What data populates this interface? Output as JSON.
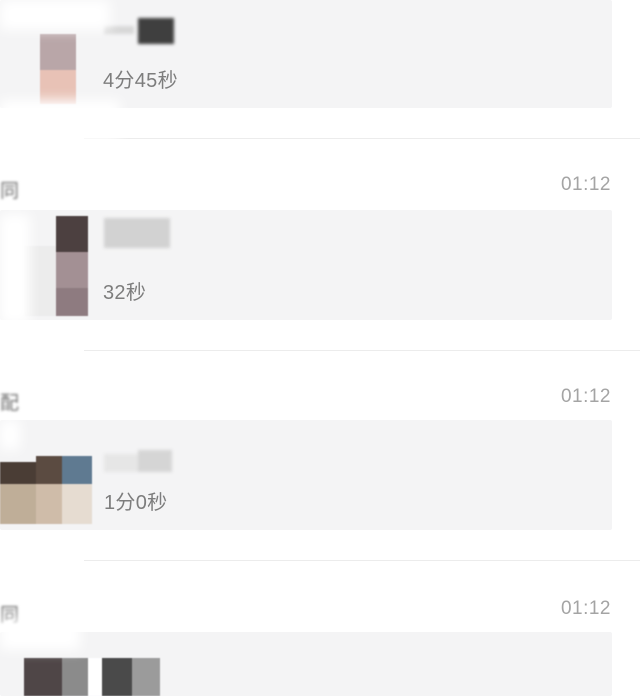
{
  "entries": [
    {
      "sender": "",
      "time": "",
      "duration": "4分45秒"
    },
    {
      "sender": "同",
      "time": "01:12",
      "duration": "32秒"
    },
    {
      "sender": "配",
      "time": "01:12",
      "duration": "1分0秒"
    },
    {
      "sender": "同",
      "time": "01:12",
      "duration": ""
    }
  ],
  "colors": {
    "card_bg": "#f4f4f5",
    "timestamp": "#a4a4a4",
    "duration": "#7d7d7d"
  }
}
